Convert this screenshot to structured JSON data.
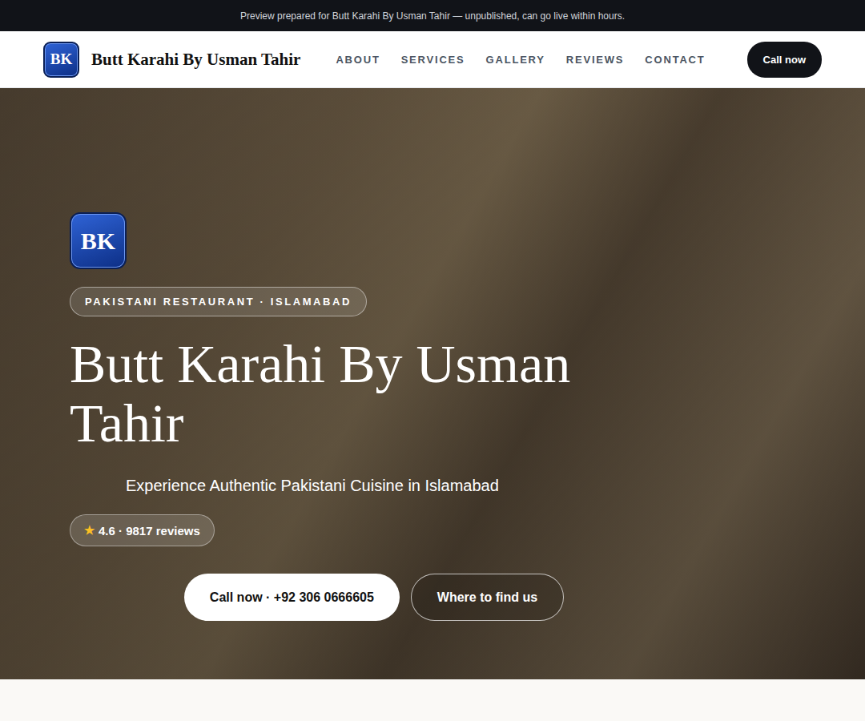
{
  "banner": "Preview prepared for Butt Karahi By Usman Tahir — unpublished, can go live within hours.",
  "header": {
    "logo": "BK",
    "brand": "Butt Karahi By Usman Tahir",
    "nav": [
      "ABOUT",
      "SERVICES",
      "GALLERY",
      "REVIEWS",
      "CONTACT"
    ],
    "cta": "Call now"
  },
  "hero": {
    "logo": "BK",
    "tag": "PAKISTANI RESTAURANT · ISLAMABAD",
    "title": "Butt Karahi By Usman Tahir",
    "subtitle": "Experience Authentic Pakistani Cuisine in Islamabad",
    "rating": {
      "star": "★",
      "text": "4.6 · 9817 reviews"
    },
    "buttons": [
      "Call now · +92 306 0666605",
      "Where to find us"
    ]
  }
}
